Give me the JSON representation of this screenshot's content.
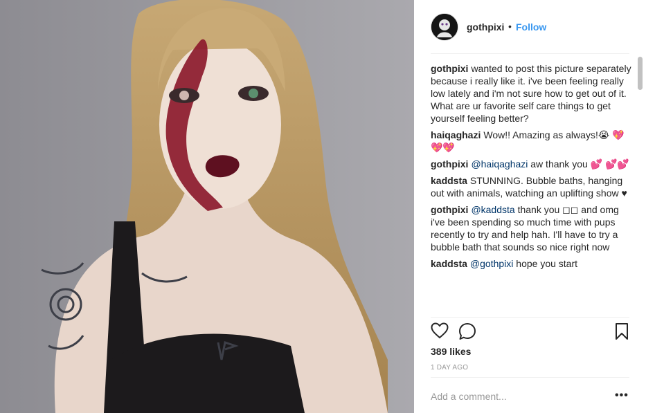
{
  "post": {
    "username": "gothpixi",
    "separator": "•",
    "follow_label": "Follow",
    "caption": {
      "user": "gothpixi",
      "text": "wanted to post this picture separately because i really like it. i've been feeling really low lately and i'm not sure how to get out of it. What are ur favorite self care things to get yourself feeling better?"
    },
    "comments": [
      {
        "user": "haiqaghazi",
        "mention": "",
        "text": "Wow!! Amazing as always!😭 💖💖💖"
      },
      {
        "user": "gothpixi",
        "mention": "@haiqaghazi",
        "text": "aw thank you 💕 💕💕"
      },
      {
        "user": "kaddsta",
        "mention": "",
        "text": "STUNNING. Bubble baths, hanging out with animals, watching an uplifting show ♥"
      },
      {
        "user": "gothpixi",
        "mention": "@kaddsta",
        "text": "thank you ◻◻ and omg i've been spending so much time with pups recently to try and help hah. I'll have to try a bubble bath that sounds so nice right now"
      },
      {
        "user": "kaddsta",
        "mention": "@gothpixi",
        "text": "hope you start"
      }
    ],
    "likes": "389 likes",
    "timestamp": "1 DAY AGO",
    "comment_placeholder": "Add a comment...",
    "more_label": "•••"
  },
  "icons": {
    "like": "heart-icon",
    "comment": "speech-bubble-icon",
    "save": "bookmark-icon",
    "more": "more-options-icon"
  },
  "colors": {
    "follow": "#3897f0",
    "mention": "#003569",
    "muted": "#999999",
    "divider": "#efefef"
  }
}
